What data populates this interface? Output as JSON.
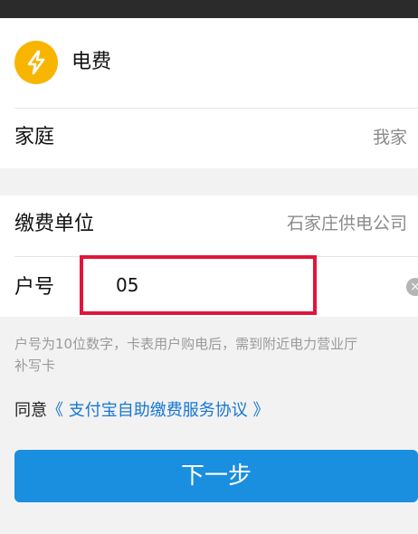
{
  "service": {
    "icon": "lightning-bolt-icon",
    "title": "电费"
  },
  "household": {
    "label": "家庭",
    "value": "我家"
  },
  "payment_unit": {
    "label": "缴费单位",
    "value": "石家庄供电公司"
  },
  "account": {
    "label": "户号",
    "value": "05",
    "clear_icon": "clear-icon"
  },
  "hint": {
    "line1": "户号为10位数字，卡表用户购电后，需到附近电力营业厅",
    "line2": "补写卡"
  },
  "agreement": {
    "prefix": "同意",
    "link": "《 支付宝自助缴费服务协议 》"
  },
  "next_button": {
    "label": "下一步"
  },
  "colors": {
    "accent": "#1a8fe0",
    "icon_bg": "#f7b500",
    "highlight_border": "#e0163a",
    "link": "#1677d2"
  }
}
